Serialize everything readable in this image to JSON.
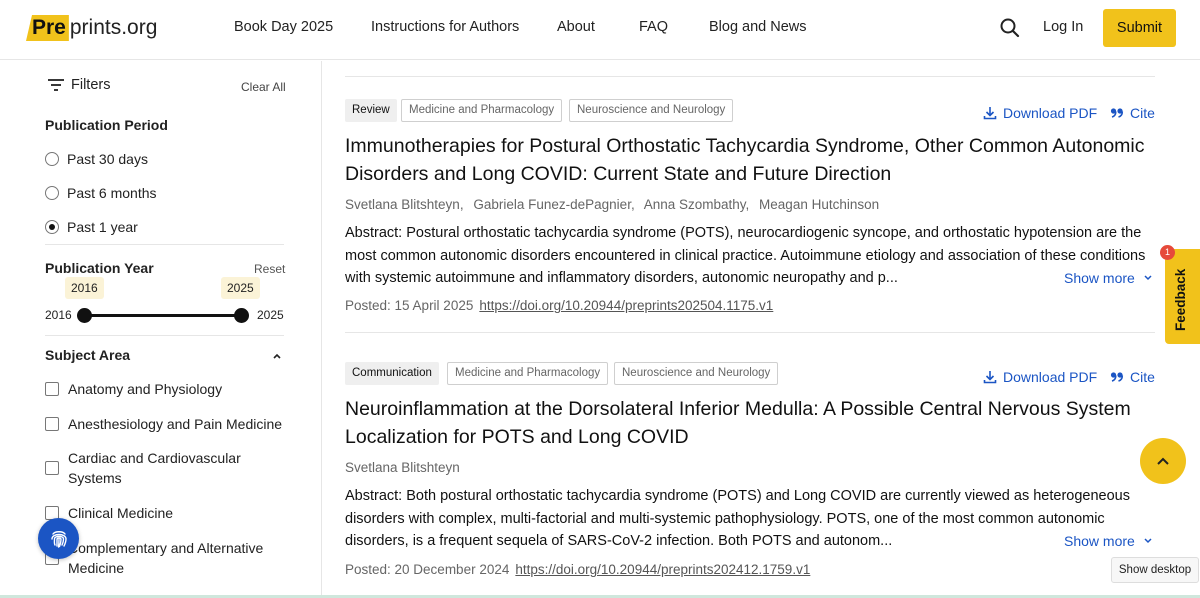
{
  "header": {
    "logo_pre": "Pre",
    "logo_rest": "prints.org",
    "nav": [
      "Book Day 2025",
      "Instructions for Authors",
      "About",
      "FAQ",
      "Blog and News"
    ],
    "login": "Log In",
    "submit": "Submit"
  },
  "sidebar": {
    "filters_label": "Filters",
    "clear_all": "Clear All",
    "period": {
      "title": "Publication Period",
      "options": [
        {
          "label": "Past 30 days",
          "checked": false
        },
        {
          "label": "Past 6 months",
          "checked": false
        },
        {
          "label": "Past 1 year",
          "checked": true
        }
      ]
    },
    "year": {
      "title": "Publication Year",
      "reset": "Reset",
      "min": "2016",
      "max": "2025",
      "from": "2016",
      "to": "2025"
    },
    "subject": {
      "title": "Subject Area",
      "items": [
        "Anatomy and Physiology",
        "Anesthesiology and Pain Medicine",
        "Cardiac and Cardiovascular Systems",
        "Clinical Medicine",
        "Complementary and Alternative Medicine"
      ]
    }
  },
  "articles": [
    {
      "type": "Review",
      "subjects": [
        "Medicine and Pharmacology",
        "Neuroscience and Neurology"
      ],
      "download": "Download PDF",
      "cite": "Cite",
      "title": "Immunotherapies for Postural Orthostatic Tachycardia Syndrome, Other Common Autonomic Disorders and Long COVID: Current State and Future Direction",
      "authors": [
        "Svetlana Blitshteyn,",
        "Gabriela Funez-dePagnier,",
        "Anna Szombathy,",
        "Meagan Hutchinson"
      ],
      "abstract": "Abstract: Postural orthostatic tachycardia syndrome (POTS), neurocardiogenic syncope, and orthostatic hypotension are the most common autonomic disorders encountered in clinical practice. Autoimmune etiology and association of these conditions with systemic autoimmune and inflammatory disorders, autonomic neuropathy and p...",
      "show_more": "Show more",
      "posted": "Posted: 15 April 2025",
      "doi": "https://doi.org/10.20944/preprints202504.1175.v1"
    },
    {
      "type": "Communication",
      "subjects": [
        "Medicine and Pharmacology",
        "Neuroscience and Neurology"
      ],
      "download": "Download PDF",
      "cite": "Cite",
      "title": "Neuroinflammation at the Dorsolateral Inferior Medulla: A Possible Central Nervous System Localization for POTS and Long COVID",
      "authors": [
        "Svetlana Blitshteyn"
      ],
      "abstract": "Abstract: Both postural orthostatic tachycardia syndrome (POTS) and Long COVID are currently viewed as heterogeneous disorders with complex, multi-factorial and multi-systemic pathophysiology. POTS, one of the most common autonomic disorders, is a frequent sequela of SARS-CoV-2 infection. Both POTS and autonom...",
      "show_more": "Show more",
      "posted": "Posted: 20 December 2024",
      "doi": "https://doi.org/10.20944/preprints202412.1759.v1"
    }
  ],
  "widgets": {
    "feedback": "Feedback",
    "feedback_badge": "1",
    "show_desktop": "Show desktop"
  },
  "colors": {
    "brand_yellow": "#f1c21b",
    "link_blue": "#1b55c4",
    "badge_red": "#e64a3b"
  }
}
